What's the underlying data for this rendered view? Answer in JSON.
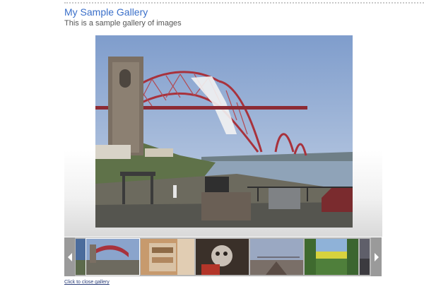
{
  "gallery": {
    "title": "My Sample Gallery",
    "subtitle": "This is a sample gallery of images"
  },
  "filmstrip": {
    "prev_icon": "chevron-left-icon",
    "next_icon": "chevron-right-icon"
  },
  "footer": {
    "close_label": "Click to close gallery"
  },
  "colors": {
    "title": "#3a6fc9",
    "link": "#2c3f7a",
    "bridge": "#a8323c",
    "sky": "#9fb6d9"
  }
}
